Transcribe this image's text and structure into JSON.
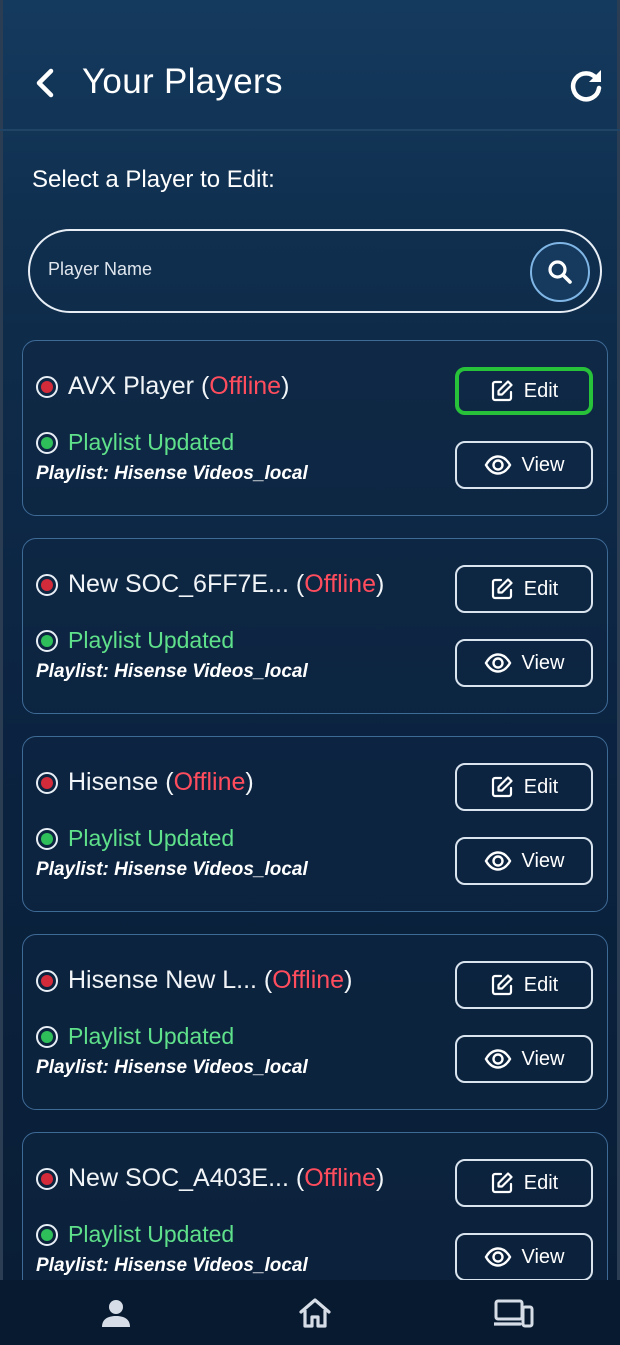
{
  "header": {
    "title": "Your Players",
    "back_icon": "chevron-left-icon",
    "refresh_icon": "refresh-icon"
  },
  "subtitle": "Select a Player to Edit:",
  "search": {
    "placeholder": "Player Name",
    "icon": "search-icon"
  },
  "players": [
    {
      "name": "AVX Player",
      "state": "Offline",
      "status": "Playlist Updated",
      "playlist": "Playlist: Hisense Videos_local",
      "edit_label": "Edit",
      "view_label": "View"
    },
    {
      "name": "New SOC_6FF7E...",
      "state": "Offline",
      "status": "Playlist Updated",
      "playlist": "Playlist: Hisense Videos_local",
      "edit_label": "Edit",
      "view_label": "View"
    },
    {
      "name": "Hisense",
      "state": "Offline",
      "status": "Playlist Updated",
      "playlist": "Playlist: Hisense Videos_local",
      "edit_label": "Edit",
      "view_label": "View"
    },
    {
      "name": "Hisense New L...",
      "state": "Offline",
      "status": "Playlist Updated",
      "playlist": "Playlist: Hisense Videos_local",
      "edit_label": "Edit",
      "view_label": "View"
    },
    {
      "name": "New SOC_A403E...",
      "state": "Offline",
      "status": "Playlist Updated",
      "playlist": "Playlist: Hisense Videos_local",
      "edit_label": "Edit",
      "view_label": "View"
    }
  ],
  "navbar": {
    "items": [
      "user-icon",
      "home-icon",
      "devices-icon"
    ]
  },
  "colors": {
    "offline": "#ff4d5e",
    "updated": "#5fe08a",
    "highlight": "#28c13a",
    "card_border": "#3e6a96"
  }
}
